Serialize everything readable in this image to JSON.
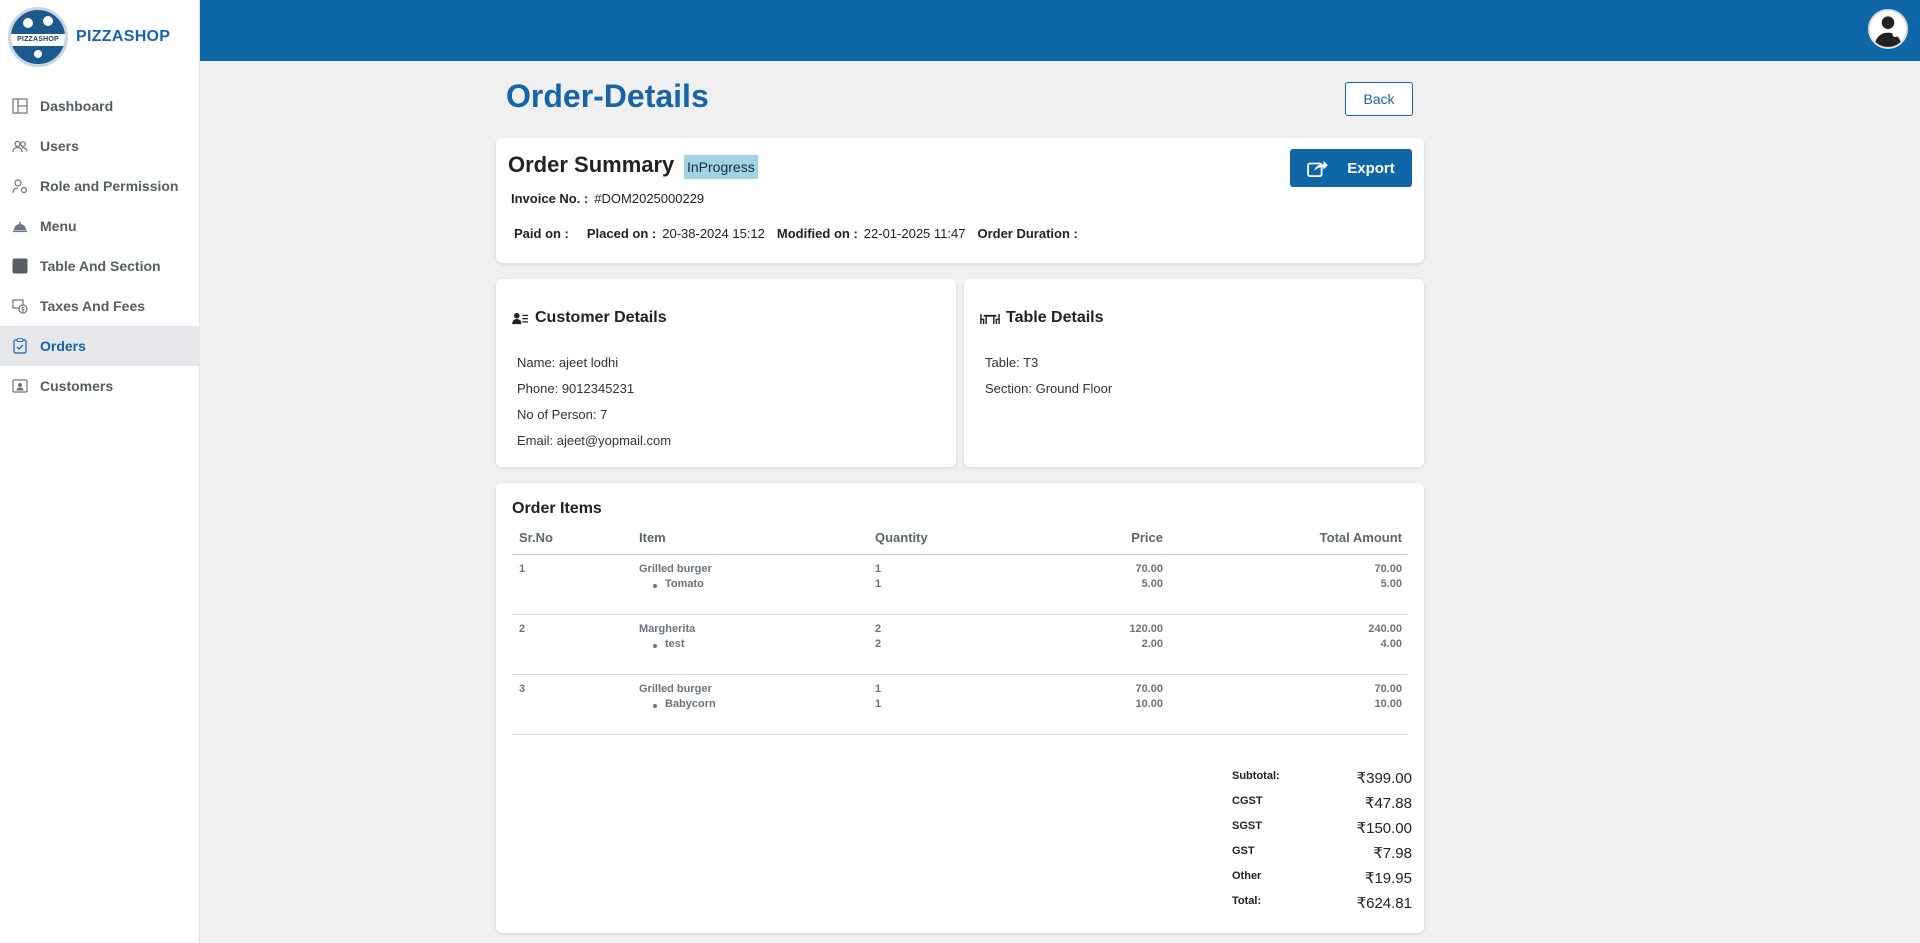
{
  "brand": {
    "name": "PIZZASHOP",
    "logo_text": "PIZZASHOP"
  },
  "sidebar": {
    "items": [
      {
        "label": "Dashboard",
        "icon": "dashboard-grid-icon"
      },
      {
        "label": "Users",
        "icon": "users-icon"
      },
      {
        "label": "Role and Permission",
        "icon": "role-permission-icon"
      },
      {
        "label": "Menu",
        "icon": "cloche-icon"
      },
      {
        "label": "Table And Section",
        "icon": "table-square-icon"
      },
      {
        "label": "Taxes And Fees",
        "icon": "taxes-icon"
      },
      {
        "label": "Orders",
        "icon": "clipboard-check-icon",
        "active": true
      },
      {
        "label": "Customers",
        "icon": "customer-card-icon"
      }
    ]
  },
  "header": {
    "accent": "#0f67a8"
  },
  "page": {
    "title": "Order-Details",
    "back_label": "Back"
  },
  "summary": {
    "title": "Order Summary",
    "status": "InProgress",
    "export_label": "Export",
    "invoice_label": "Invoice No. :",
    "invoice_value": "#DOM2025000229",
    "paid_label": "Paid on :",
    "paid_value": "",
    "placed_label": "Placed on :",
    "placed_value": "20-38-2024 15:12",
    "modified_label": "Modified on :",
    "modified_value": "22-01-2025 11:47",
    "duration_label": "Order Duration :",
    "duration_value": ""
  },
  "customer": {
    "title": "Customer Details",
    "name": "Name: ajeet lodhi",
    "phone": "Phone: 9012345231",
    "persons": "No of Person: 7",
    "email": "Email: ajeet@yopmail.com"
  },
  "table_details": {
    "title": "Table Details",
    "table": "Table: T3",
    "section": "Section: Ground Floor"
  },
  "items": {
    "title": "Order Items",
    "headers": [
      "Sr.No",
      "Item",
      "Quantity",
      "Price",
      "Total Amount"
    ],
    "rows": [
      {
        "sr": "1",
        "item": "Grilled burger",
        "qty": "1",
        "price": "70.00",
        "total": "70.00",
        "mod": {
          "name": "Tomato",
          "qty": "1",
          "price": "5.00",
          "total": "5.00"
        }
      },
      {
        "sr": "2",
        "item": "Margherita",
        "qty": "2",
        "price": "120.00",
        "total": "240.00",
        "mod": {
          "name": "test",
          "qty": "2",
          "price": "2.00",
          "total": "4.00"
        }
      },
      {
        "sr": "3",
        "item": "Grilled burger",
        "qty": "1",
        "price": "70.00",
        "total": "70.00",
        "mod": {
          "name": "Babycorn",
          "qty": "1",
          "price": "10.00",
          "total": "10.00"
        }
      }
    ]
  },
  "totals": [
    {
      "label": "Subtotal:",
      "value": "₹399.00"
    },
    {
      "label": "CGST",
      "value": "₹47.88"
    },
    {
      "label": "SGST",
      "value": "₹150.00"
    },
    {
      "label": "GST",
      "value": "₹7.98"
    },
    {
      "label": "Other",
      "value": "₹19.95"
    },
    {
      "label": "Total:",
      "value": "₹624.81"
    }
  ]
}
